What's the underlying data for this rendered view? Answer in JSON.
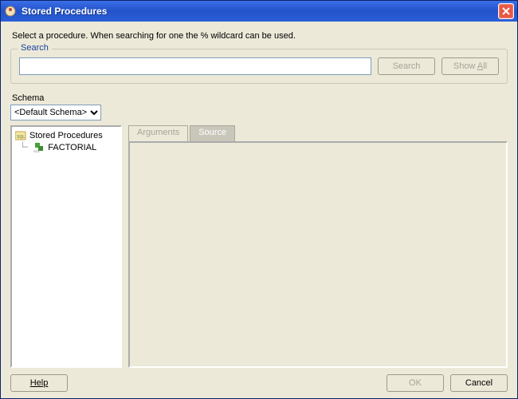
{
  "title": "Stored Procedures",
  "instruction": "Select a procedure. When searching for one the % wildcard can be used.",
  "search": {
    "legend": "Search",
    "value": "",
    "placeholder": "",
    "search_btn": "Search",
    "showall_btn": "Show All"
  },
  "schema": {
    "label": "Schema",
    "selected": "<Default Schema>",
    "options": [
      "<Default Schema>"
    ]
  },
  "tree": {
    "root_label": "Stored Procedures",
    "items": [
      "FACTORIAL"
    ]
  },
  "tabs": {
    "arguments": "Arguments",
    "source": "Source",
    "active": "source"
  },
  "footer": {
    "help": "Help",
    "ok": "OK",
    "cancel": "Cancel"
  }
}
